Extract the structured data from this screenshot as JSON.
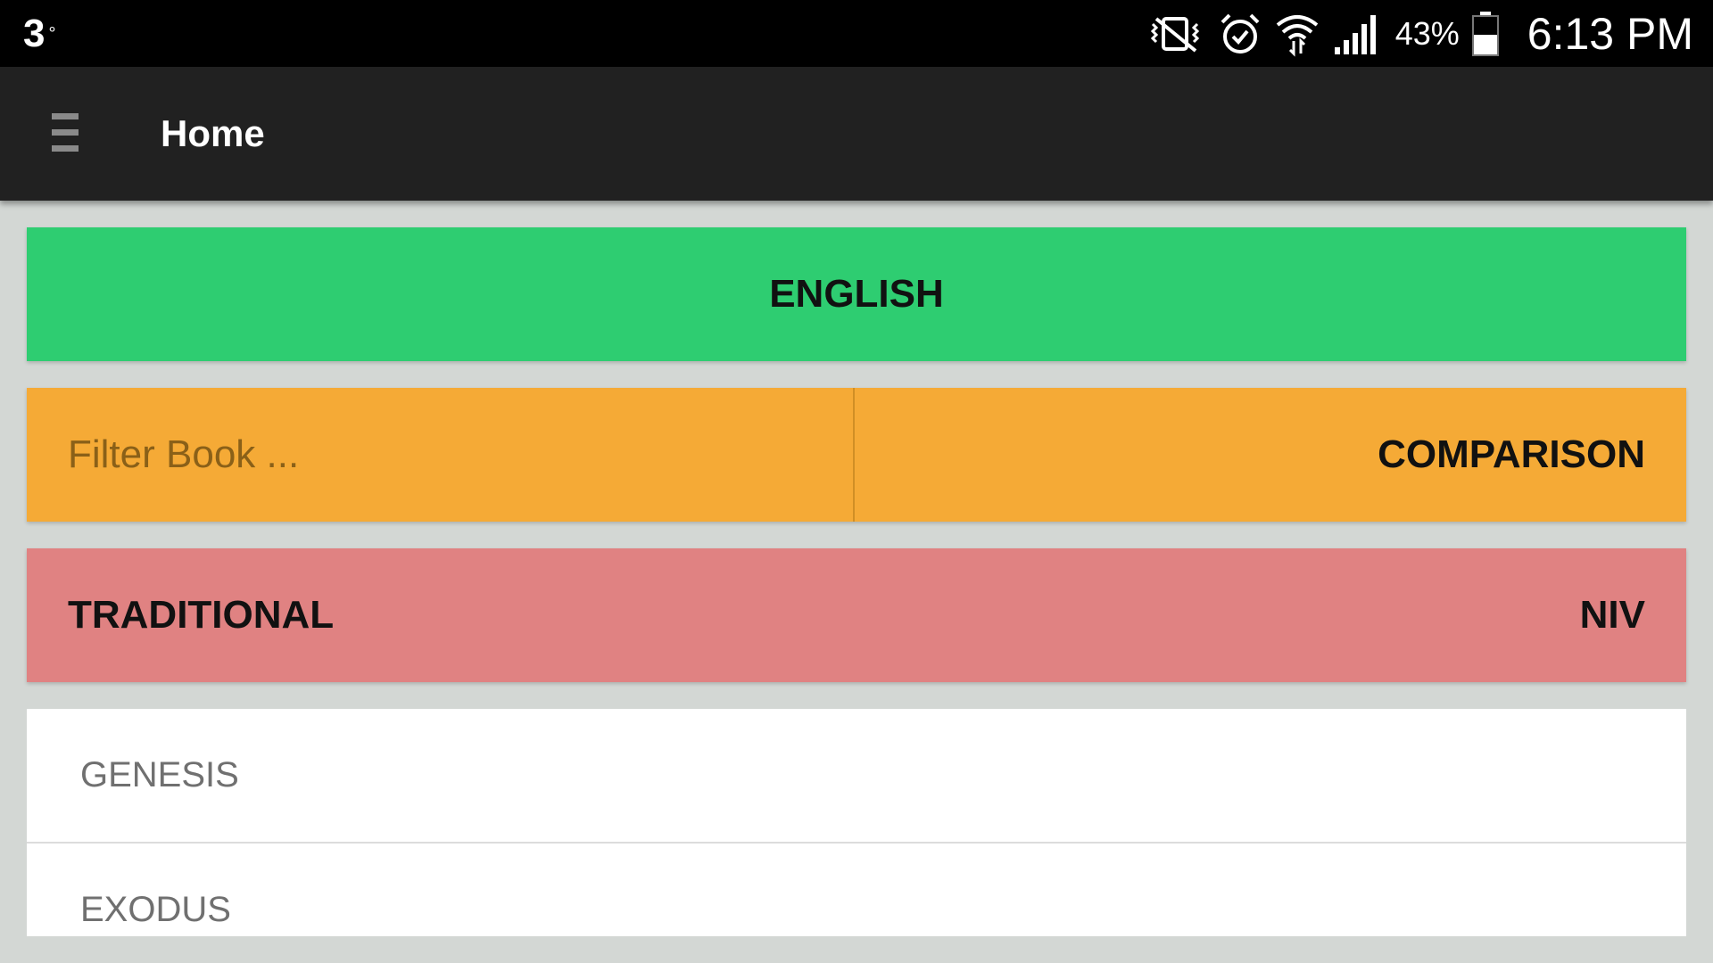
{
  "status_bar": {
    "notification": "3",
    "notification_degree": "°",
    "icons": [
      "vibrate-mute-icon",
      "alarm-icon",
      "wifi-icon",
      "signal-icon",
      "battery-icon"
    ],
    "battery": "43%",
    "time": "6:13 PM"
  },
  "app_bar": {
    "menu_icon": "hamburger-menu-icon",
    "title": "Home"
  },
  "language": {
    "label": "ENGLISH",
    "color": "#2ecd71"
  },
  "filter": {
    "placeholder": "Filter Book ...",
    "value": "",
    "comparison_label": "COMPARISON",
    "color": "#f5aa36"
  },
  "version": {
    "script_label": "TRADITIONAL",
    "translation_label": "NIV",
    "color": "#e08282"
  },
  "books": [
    {
      "name": "GENESIS"
    },
    {
      "name": "EXODUS"
    }
  ]
}
